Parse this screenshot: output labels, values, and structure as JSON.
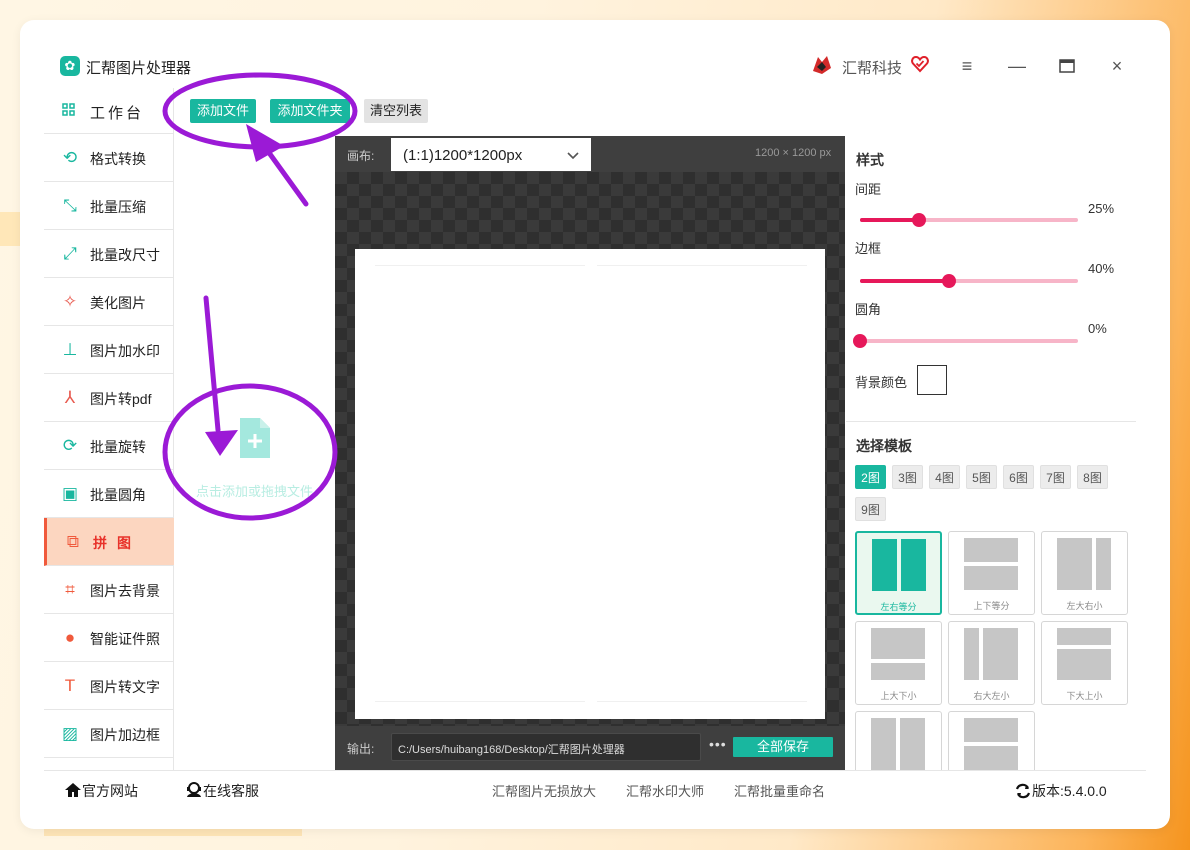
{
  "app": {
    "title": "汇帮图片处理器",
    "brand": "汇帮科技",
    "logo_icon": "photo-logo-icon"
  },
  "window_controls": {
    "menu": "≡",
    "minimize": "—",
    "maximize": "□",
    "close": "×"
  },
  "sidebar": {
    "workbench": "工作台",
    "items": [
      {
        "label": "格式转换",
        "icon": "convert-icon",
        "color": "#19b79f"
      },
      {
        "label": "批量压缩",
        "icon": "compress-icon",
        "color": "#19b79f"
      },
      {
        "label": "批量改尺寸",
        "icon": "resize-icon",
        "color": "#19b79f"
      },
      {
        "label": "美化图片",
        "icon": "beautify-icon",
        "color": "#e85a4f"
      },
      {
        "label": "图片加水印",
        "icon": "stamp-icon",
        "color": "#19b79f"
      },
      {
        "label": "图片转pdf",
        "icon": "pdf-icon",
        "color": "#e85a4f"
      },
      {
        "label": "批量旋转",
        "icon": "rotate-icon",
        "color": "#19b79f"
      },
      {
        "label": "批量圆角",
        "icon": "round-corner-icon",
        "color": "#19b79f"
      },
      {
        "label": "拼图",
        "icon": "puzzle-icon",
        "color": "#f05a3c",
        "active": true
      },
      {
        "label": "图片去背景",
        "icon": "crop-icon",
        "color": "#f05a3c"
      },
      {
        "label": "智能证件照",
        "icon": "person-icon",
        "color": "#f05a3c"
      },
      {
        "label": "图片转文字",
        "icon": "text-icon",
        "color": "#f05a3c"
      },
      {
        "label": "图片加边框",
        "icon": "frame-icon",
        "color": "#19b79f"
      }
    ]
  },
  "toolbar": {
    "add_file": "添加文件",
    "add_folder": "添加文件夹",
    "clear_list": "清空列表"
  },
  "dropzone": {
    "hint": "点击添加或拖拽文件"
  },
  "canvas": {
    "label": "画布:",
    "preset": "(1:1)1200*1200px",
    "dimensions": "1200 × 1200 px"
  },
  "output": {
    "label": "输出:",
    "path": "C:/Users/huibang168/Desktop/汇帮图片处理器",
    "more": "•••",
    "save_all": "全部保存"
  },
  "style": {
    "title": "样式",
    "spacing": {
      "label": "间距",
      "value": "25%",
      "fraction": 0.27
    },
    "border": {
      "label": "边框",
      "value": "40%",
      "fraction": 0.41
    },
    "corner": {
      "label": "圆角",
      "value": "0%",
      "fraction": 0.0
    },
    "bg_color": {
      "label": "背景颜色",
      "color": "#ffffff"
    },
    "accent": "#e6185a"
  },
  "templates": {
    "title": "选择模板",
    "counts": [
      "2图",
      "3图",
      "4图",
      "5图",
      "6图",
      "7图",
      "8图",
      "9图"
    ],
    "active_count": "2图",
    "items": [
      {
        "label": "左右等分",
        "active": true
      },
      {
        "label": "上下等分"
      },
      {
        "label": "左大右小"
      },
      {
        "label": "上大下小"
      },
      {
        "label": "右大左小"
      },
      {
        "label": "下大上小"
      },
      {
        "label": ""
      },
      {
        "label": ""
      }
    ]
  },
  "footer": {
    "website": "官方网站",
    "support": "在线客服",
    "links": [
      "汇帮图片无损放大",
      "汇帮水印大师",
      "汇帮批量重命名"
    ],
    "version_label": "版本:",
    "version": "5.4.0.0"
  },
  "annotation_color": "#9b1ad6"
}
